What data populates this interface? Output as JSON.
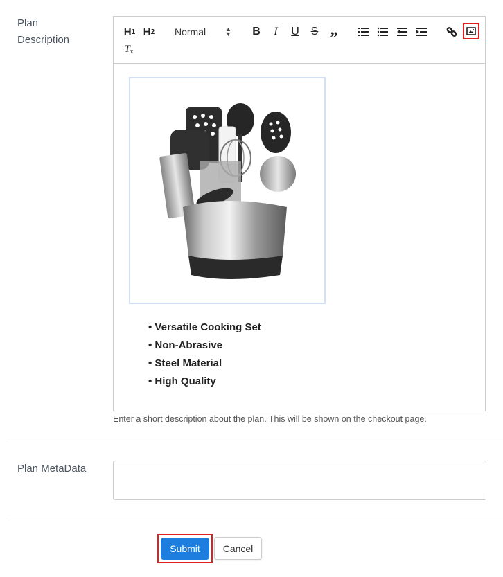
{
  "description_field": {
    "label_line1": "Plan",
    "label_line2": "Description",
    "toolbar": {
      "h1": "H",
      "h1_sub": "1",
      "h2": "H",
      "h2_sub": "2",
      "format_select": "Normal",
      "buttons": [
        "bold-icon",
        "italic-icon",
        "underline-icon",
        "strike-icon",
        "blockquote-icon",
        "ordered-list-icon",
        "bullet-list-icon",
        "outdent-icon",
        "indent-icon",
        "link-icon",
        "image-icon",
        "clear-format-icon"
      ]
    },
    "image_alt": "Kitchen utensil set in stainless steel holder",
    "bullets": [
      "• Versatile Cooking Set",
      "• Non-Abrasive",
      "• Steel Material",
      "•  High Quality"
    ],
    "help_text": "Enter a short description about the plan. This will be shown on the checkout page."
  },
  "metadata_field": {
    "label": "Plan MetaData",
    "value": ""
  },
  "actions": {
    "submit_label": "Submit",
    "cancel_label": "Cancel"
  },
  "colors": {
    "primary": "#1d7ee0",
    "highlight": "#e02020"
  }
}
